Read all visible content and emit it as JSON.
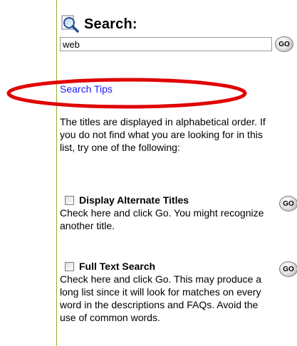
{
  "search": {
    "title": "Search:",
    "input_value": "web",
    "go_label": "GO",
    "tips_link": "Search Tips"
  },
  "description": "The titles are displayed in alphabetical order. If you do not find what you are looking for in this list, try one of the following:",
  "options": [
    {
      "label": "Display Alternate Titles",
      "text": "Check here and click Go. You might recognize another title.",
      "go_label": "GO"
    },
    {
      "label": "Full Text Search",
      "text": "Check here and click Go. This may produce a long list since it will look for matches on every word in the descriptions and FAQs. Avoid the use of common words.",
      "go_label": "GO"
    }
  ],
  "colors": {
    "link": "#1a1aff",
    "highlight": "#e00000",
    "panel_border": "#8fb030"
  },
  "icons": {
    "search": "magnifier-icon",
    "highlight": "red-ellipse-annotation"
  }
}
